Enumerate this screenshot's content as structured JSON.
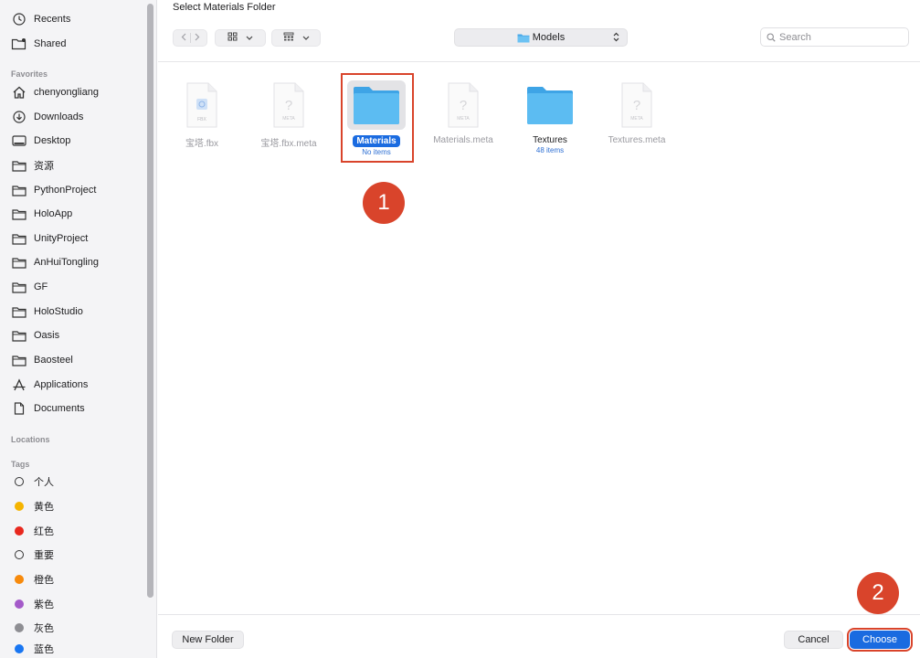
{
  "dialog": {
    "title": "Select Materials Folder"
  },
  "sidebar": {
    "top_items": [
      {
        "label": "Recents",
        "icon": "clock-icon"
      },
      {
        "label": "Shared",
        "icon": "shared-folder-icon"
      }
    ],
    "favorites_header": "Favorites",
    "favorites": [
      {
        "label": "chenyongliang",
        "icon": "home-icon"
      },
      {
        "label": "Downloads",
        "icon": "download-icon"
      },
      {
        "label": "Desktop",
        "icon": "desktop-icon"
      },
      {
        "label": "资源",
        "icon": "folder-icon"
      },
      {
        "label": "PythonProject",
        "icon": "folder-icon"
      },
      {
        "label": "HoloApp",
        "icon": "folder-icon"
      },
      {
        "label": "UnityProject",
        "icon": "folder-icon"
      },
      {
        "label": "AnHuiTongling",
        "icon": "folder-icon"
      },
      {
        "label": "GF",
        "icon": "folder-icon"
      },
      {
        "label": "HoloStudio",
        "icon": "folder-icon"
      },
      {
        "label": "Oasis",
        "icon": "folder-icon"
      },
      {
        "label": "Baosteel",
        "icon": "folder-icon"
      },
      {
        "label": "Applications",
        "icon": "applications-icon"
      },
      {
        "label": "Documents",
        "icon": "document-icon"
      }
    ],
    "locations_header": "Locations",
    "tags_header": "Tags",
    "tags": [
      {
        "label": "个人",
        "color": ""
      },
      {
        "label": "黄色",
        "color": "#f5b400"
      },
      {
        "label": "红色",
        "color": "#e8281e"
      },
      {
        "label": "重要",
        "color": ""
      },
      {
        "label": "橙色",
        "color": "#f78a0c"
      },
      {
        "label": "紫色",
        "color": "#a45ac9"
      },
      {
        "label": "灰色",
        "color": "#8e8e93"
      },
      {
        "label": "蓝色",
        "color": "#1976f2"
      }
    ]
  },
  "toolbar": {
    "back_icon": "chevron-left-icon",
    "forward_icon": "chevron-right-icon",
    "view_icon": "grid-view-icon",
    "group_icon": "group-view-icon",
    "path_label": "Models",
    "search_placeholder": "Search"
  },
  "files": [
    {
      "name": "宝塔.fbx",
      "kind": "fbx",
      "badge": "FBX"
    },
    {
      "name": "宝塔.fbx.meta",
      "kind": "meta",
      "badge": "META"
    },
    {
      "name": "Materials",
      "kind": "folder",
      "sub": "No items",
      "selected": true
    },
    {
      "name": "Materials.meta",
      "kind": "meta",
      "badge": "META"
    },
    {
      "name": "Textures",
      "kind": "folder",
      "sub": "48 items"
    },
    {
      "name": "Textures.meta",
      "kind": "meta",
      "badge": "META"
    }
  ],
  "annotations": {
    "step1": "1",
    "step2": "2"
  },
  "buttons": {
    "new_folder": "New Folder",
    "cancel": "Cancel",
    "choose": "Choose"
  },
  "colors": {
    "accent": "#1a6be0",
    "annotation": "#d9442b",
    "folder": "#56b7ef"
  }
}
